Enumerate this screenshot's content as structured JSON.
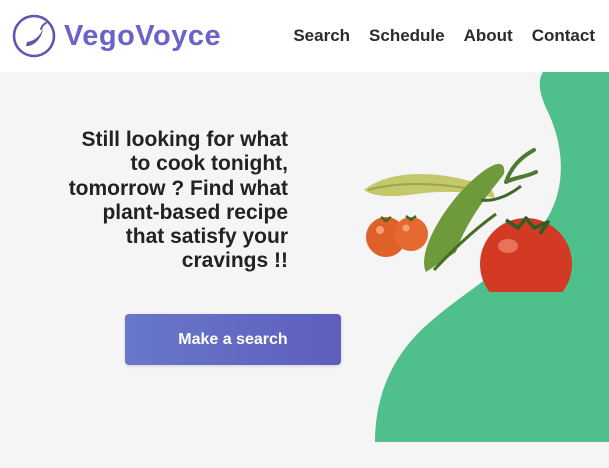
{
  "header": {
    "brand": "VegoVoyce",
    "nav": [
      "Search",
      "Schedule",
      "About",
      "Contact"
    ]
  },
  "hero": {
    "headline": "Still looking for what to cook tonight, tomorrow ? Find what plant-based recipe that satisfy your cravings !!",
    "cta_label": "Make a search",
    "image": "vegetables-illustration"
  },
  "colors": {
    "brand": "#6b63c7",
    "accent_green": "#4fbf8b",
    "light_green": "#dff2e9",
    "cta_start": "#6878c9",
    "cta_end": "#5e5ebd"
  },
  "icons": [
    "eggplant-logo-icon"
  ]
}
